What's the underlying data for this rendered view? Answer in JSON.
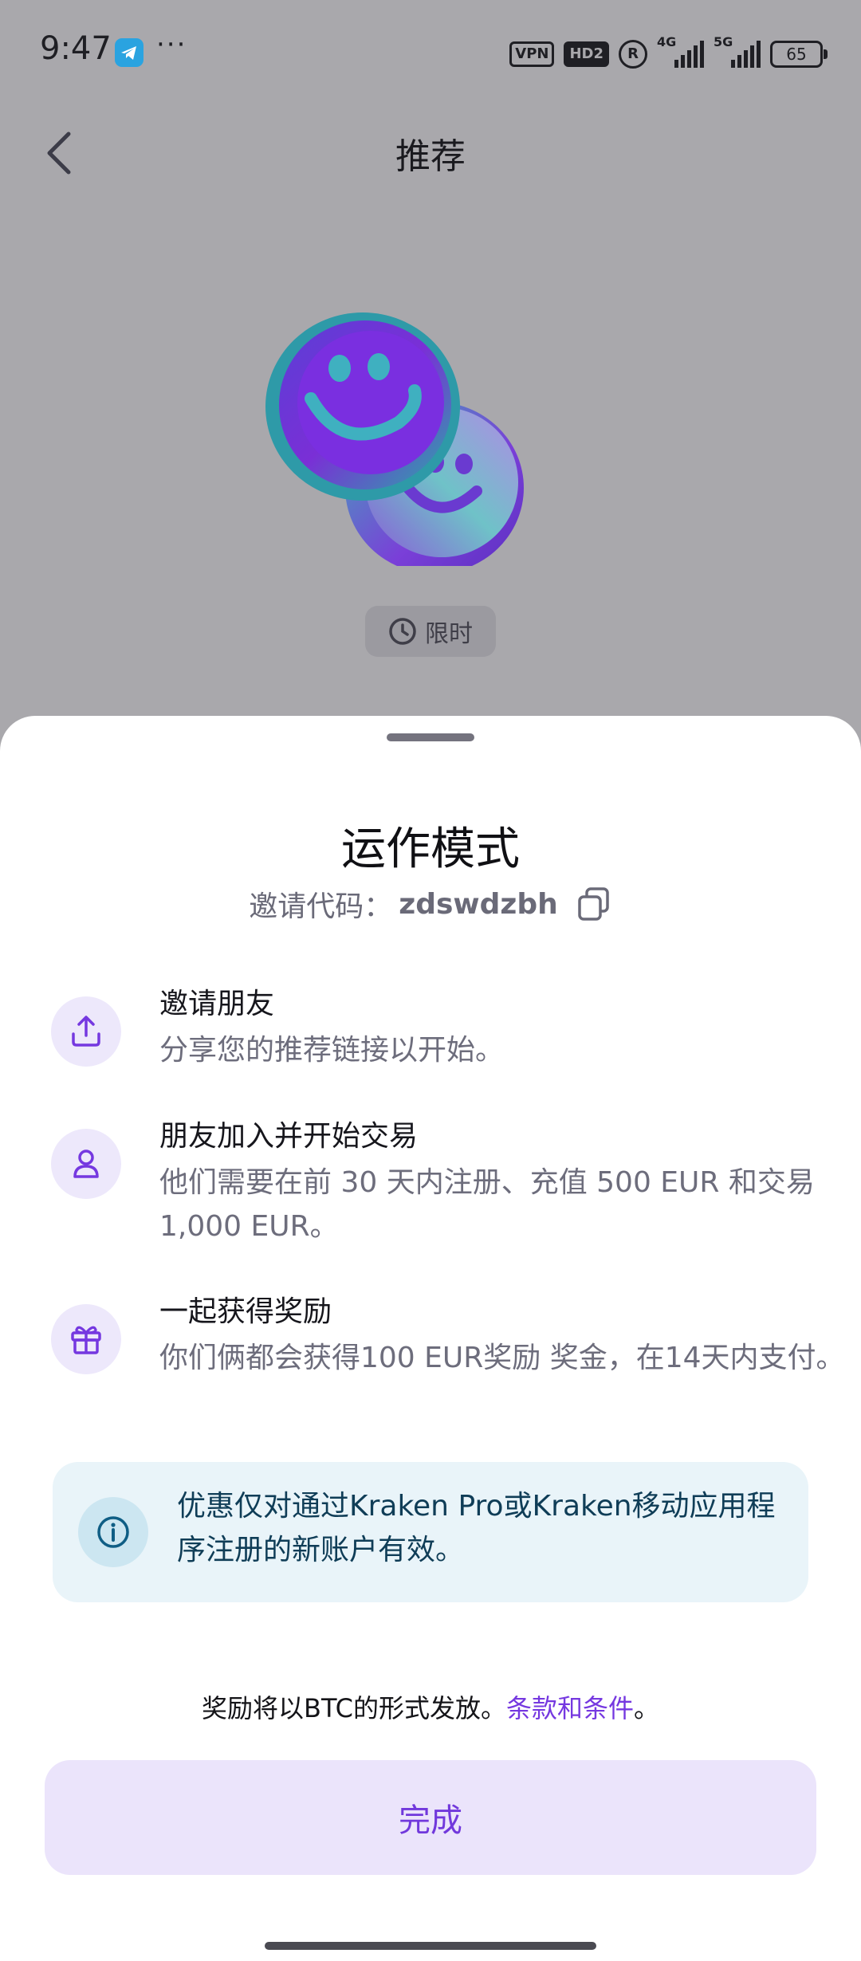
{
  "status_bar": {
    "time": "9:47",
    "more": "···",
    "vpn_badge": "VPN",
    "hd_badge": "HD2",
    "r_badge": "R",
    "signal1_label": "4G",
    "signal2_label": "5G",
    "battery": "65"
  },
  "header": {
    "title": "推荐"
  },
  "hero": {
    "limited_badge": "限时"
  },
  "sheet": {
    "title": "运作模式",
    "invite_label": "邀请代码：",
    "invite_code": "zdswdzbh",
    "steps": [
      {
        "title": "邀请朋友",
        "desc": "分享您的推荐链接以开始。",
        "icon": "share-upload-icon"
      },
      {
        "title": "朋友加入并开始交易",
        "desc": "他们需要在前 30 天内注册、充值 500 EUR 和交易 1,000 EUR。",
        "icon": "person-icon"
      },
      {
        "title": "一起获得奖励",
        "desc": "你们俩都会获得100 EUR奖励 奖金，在14天内支付。",
        "icon": "gift-icon"
      }
    ],
    "info": "优惠仅对通过Kraken Pro或Kraken移动应用程序注册的新账户有效。",
    "reward_note": "奖励将以BTC的形式发放。",
    "terms_link": "条款和条件",
    "reward_note_end": "。",
    "done_button": "完成"
  },
  "colors": {
    "accent": "#7538e0",
    "icon_bg": "#ede8fb",
    "info_bg": "#e9f4f9",
    "button_bg": "#ebe4fb",
    "overlay_bg": "#a9a8ac"
  }
}
